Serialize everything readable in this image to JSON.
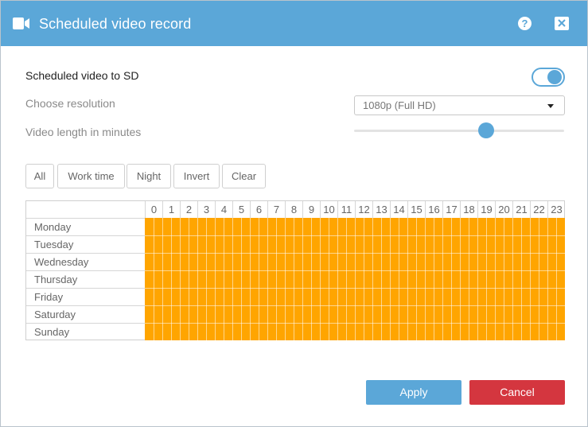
{
  "dialog": {
    "title": "Scheduled video record",
    "icon": "video-camera-icon",
    "help_label": "?",
    "close_icon": "close-icon",
    "accent_color": "#5ba7d8"
  },
  "settings": {
    "sd_label": "Scheduled video to SD",
    "sd_enabled": true,
    "resolution_label": "Choose resolution",
    "resolution_value": "1080p (Full HD)",
    "length_label": "Video length in minutes",
    "length_fraction": 0.63
  },
  "quick_buttons": [
    "All",
    "Work time",
    "Night",
    "Invert",
    "Clear"
  ],
  "schedule": {
    "hours": [
      "0",
      "1",
      "2",
      "3",
      "4",
      "5",
      "6",
      "7",
      "8",
      "9",
      "10",
      "11",
      "12",
      "13",
      "14",
      "15",
      "16",
      "17",
      "18",
      "19",
      "20",
      "21",
      "22",
      "23"
    ],
    "days": [
      "Monday",
      "Tuesday",
      "Wednesday",
      "Thursday",
      "Friday",
      "Saturday",
      "Sunday"
    ],
    "selected_color": "#ffa500",
    "all_selected": true
  },
  "footer": {
    "apply_label": "Apply",
    "cancel_label": "Cancel",
    "cancel_color": "#d4363f"
  }
}
